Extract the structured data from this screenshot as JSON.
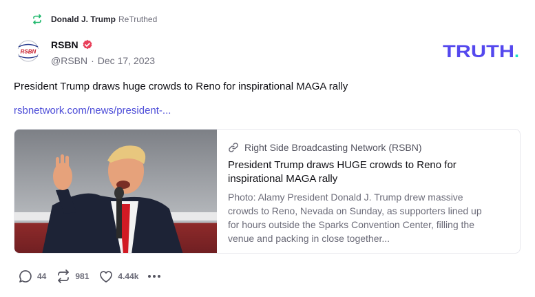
{
  "retruth": {
    "user": "Donald J. Trump",
    "suffix": "ReTruthed",
    "icon": "retruth-icon"
  },
  "author": {
    "display_name": "RSBN",
    "verified": true,
    "handle": "@RSBN",
    "separator": "·",
    "date": "Dec 17, 2023",
    "avatar_text": "RSBN"
  },
  "brand": {
    "logo_text": "TRUTH",
    "logo_dot": ".",
    "color": "#5448ee",
    "dot_color": "#17e0c6"
  },
  "post": {
    "text": "President Trump draws huge crowds to Reno for inspirational MAGA rally",
    "link": "rsbnetwork.com/news/president-..."
  },
  "card": {
    "source": "Right Side Broadcasting Network (RSBN)",
    "headline": "President Trump draws HUGE crowds to Reno for inspirational MAGA rally",
    "description": "Photo: Alamy President Donald J. Trump drew massive crowds to Reno, Nevada on Sunday, as supporters lined up for hours outside the Sparks Convention Center, filling the venue and packing in close together..."
  },
  "actions": {
    "replies": "44",
    "retruths": "981",
    "likes": "4.44k"
  },
  "colors": {
    "verified": "#e8405a",
    "link": "#4d4dd8",
    "retruth_icon": "#1fb86c"
  }
}
